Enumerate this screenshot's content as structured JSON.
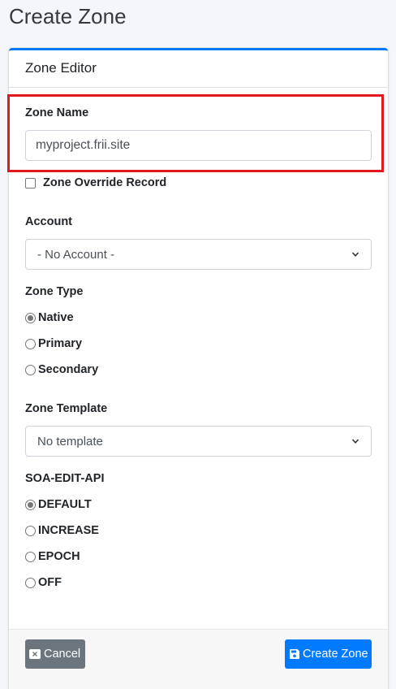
{
  "page": {
    "title": "Create Zone"
  },
  "card": {
    "title": "Zone Editor"
  },
  "zone_name": {
    "label": "Zone Name",
    "value": "myproject.frii.site"
  },
  "override": {
    "label": "Zone Override Record",
    "checked": false
  },
  "account": {
    "label": "Account",
    "selected": "- No Account -"
  },
  "zone_type": {
    "label": "Zone Type",
    "options": [
      "Native",
      "Primary",
      "Secondary"
    ],
    "selected": "Native"
  },
  "zone_template": {
    "label": "Zone Template",
    "selected": "No template"
  },
  "soa_edit_api": {
    "label": "SOA-EDIT-API",
    "options": [
      "DEFAULT",
      "INCREASE",
      "EPOCH",
      "OFF"
    ],
    "selected": "DEFAULT"
  },
  "footer": {
    "cancel_label": "Cancel",
    "create_label": "Create Zone"
  },
  "colors": {
    "accent": "#007bff",
    "highlight": "#e0191e",
    "cancel": "#6c757d"
  },
  "icons": {
    "cancel": "close-square-icon",
    "create": "save-icon",
    "select": "chevron-down-icon"
  }
}
